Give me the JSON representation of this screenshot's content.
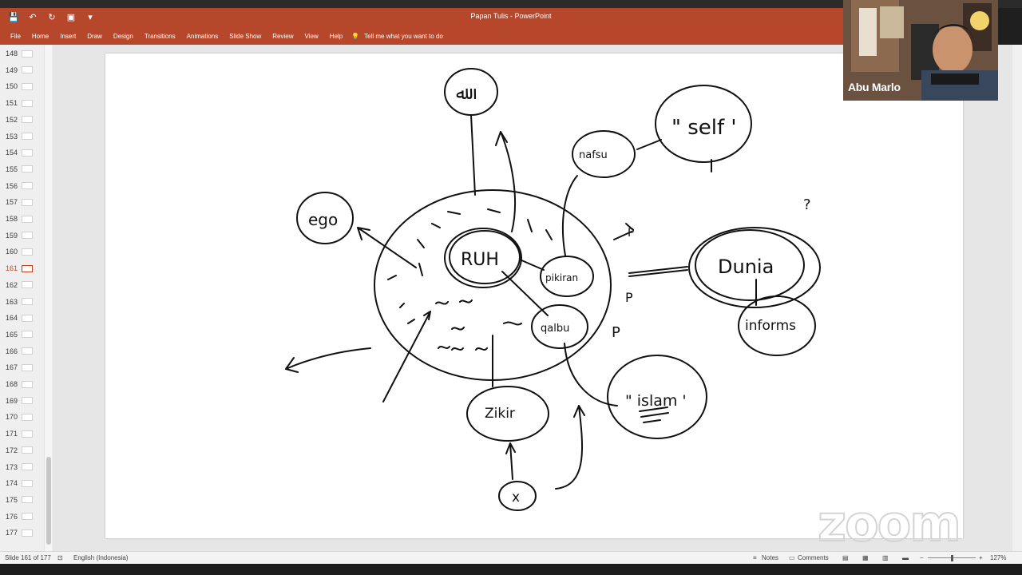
{
  "app": {
    "document_title": "Papan Tulis  -  PowerPoint"
  },
  "ribbon": {
    "tabs": [
      "File",
      "Home",
      "Insert",
      "Draw",
      "Design",
      "Transitions",
      "Animations",
      "Slide Show",
      "Review",
      "View",
      "Help"
    ],
    "tell_me": "Tell me what you want to do"
  },
  "thumbnails": {
    "numbers": [
      "148",
      "149",
      "150",
      "151",
      "152",
      "153",
      "154",
      "155",
      "156",
      "157",
      "158",
      "159",
      "160",
      "161",
      "162",
      "163",
      "164",
      "165",
      "166",
      "167",
      "168",
      "169",
      "170",
      "171",
      "172",
      "173",
      "174",
      "175",
      "176",
      "177"
    ],
    "active": "161"
  },
  "slide": {
    "labels": {
      "top": "ﷲ",
      "ego": "ego",
      "nafsu": "nafsu",
      "self": "\" self '",
      "ruh": "RUH",
      "pikiran": "pikiran",
      "qalbu": "qalbu",
      "dunia": "Dunia",
      "informs": "informs",
      "zikir": "Zikir",
      "islam": "\" islam '",
      "x": "x",
      "p1": "P",
      "p2": "P",
      "p3": "P",
      "question": "?"
    }
  },
  "video": {
    "participant_name": "Abu Marlo"
  },
  "zoom_logo": "zoom",
  "statusbar": {
    "slide_info": "Slide 161 of 177",
    "language": "English (Indonesia)",
    "notes": "Notes",
    "comments": "Comments",
    "zoom_level": "127%"
  }
}
